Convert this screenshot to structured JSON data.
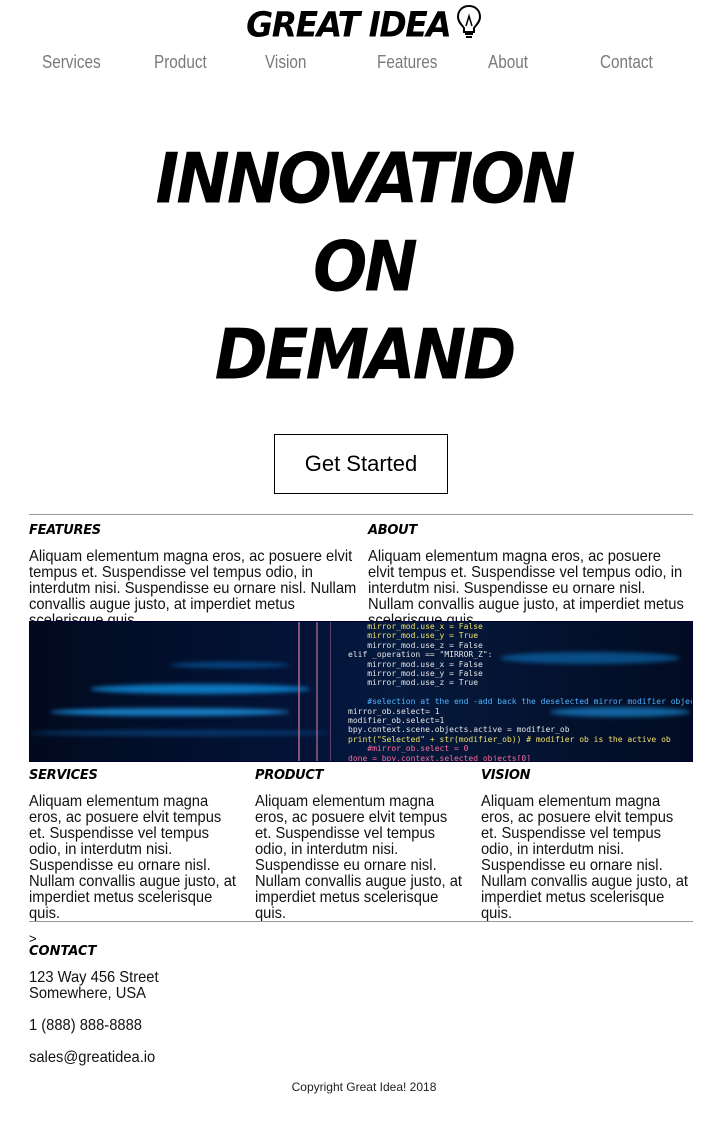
{
  "brand": {
    "name": "GREAT IDEA",
    "icon": "lightbulb-icon"
  },
  "nav": {
    "items": [
      "Services",
      "Product",
      "Vision",
      "Features",
      "About",
      "Contact"
    ]
  },
  "hero": {
    "lines": [
      "INNOVATION",
      "ON",
      "DEMAND"
    ],
    "cta_label": "Get Started"
  },
  "sections": {
    "features": {
      "title": "Features",
      "body": "Aliquam elementum magna eros, ac posuere elvit tempus et. Suspendisse vel tempus odio, in interdutm nisi. Suspendisse eu ornare nisl. Nullam convallis augue justo, at imperdiet metus scelerisque quis."
    },
    "about": {
      "title": "About",
      "body": "Aliquam elementum magna eros, ac posuere elvit tempus et. Suspendisse vel tempus odio, in interdutm nisi. Suspendisse eu ornare nisl. Nullam convallis augue justo, at imperdiet metus scelerisque quis."
    },
    "services": {
      "title": "Services",
      "body": "Aliquam elementum magna eros, ac posuere elvit tempus et. Suspendisse vel tempus odio, in interdutm nisi. Suspendisse eu ornare nisl. Nullam convallis augue justo, at imperdiet metus scelerisque quis."
    },
    "product": {
      "title": "Product",
      "body": "Aliquam elementum magna eros, ac posuere elvit tempus et. Suspendisse vel tempus odio, in interdutm nisi. Suspendisse eu ornare nisl. Nullam convallis augue justo, at imperdiet metus scelerisque quis."
    },
    "vision": {
      "title": "Vision",
      "body": "Aliquam elementum magna eros, ac posuere elvit tempus et. Suspendisse vel tempus odio, in interdutm nisi. Suspendisse eu ornare nisl. Nullam convallis augue justo, at imperdiet metus scelerisque quis."
    }
  },
  "banner": {
    "code_lines": [
      "    mirror_mod.use_x = False",
      "    mirror_mod.use_y = True",
      "    mirror_mod.use_z = False",
      "elif _operation == \"MIRROR_Z\":",
      "    mirror_mod.use_x = False",
      "    mirror_mod.use_y = False",
      "    mirror_mod.use_z = True",
      "",
      "    #selection at the end -add back the deselected mirror modifier object",
      "mirror_ob.select= 1",
      "modifier_ob.select=1",
      "bpy.context.scene.objects.active = modifier_ob",
      "print(\"Selected\" + str(modifier_ob)) # modifier ob is the active ob",
      "    #mirror_ob.select = 0",
      "done = bpy.context.selected_objects[0]"
    ]
  },
  "contact": {
    "chevron": ">",
    "title": "Contact",
    "address_line1": "123 Way 456 Street",
    "address_line2": "Somewhere, USA",
    "phone": "1 (888) 888-8888",
    "email": "sales@greatidea.io"
  },
  "footer": {
    "copyright": "Copyright Great Idea! 2018"
  },
  "colors": {
    "nav_text": "#7a7a7a",
    "rule": "#999999",
    "banner_bg": "#03143a"
  }
}
